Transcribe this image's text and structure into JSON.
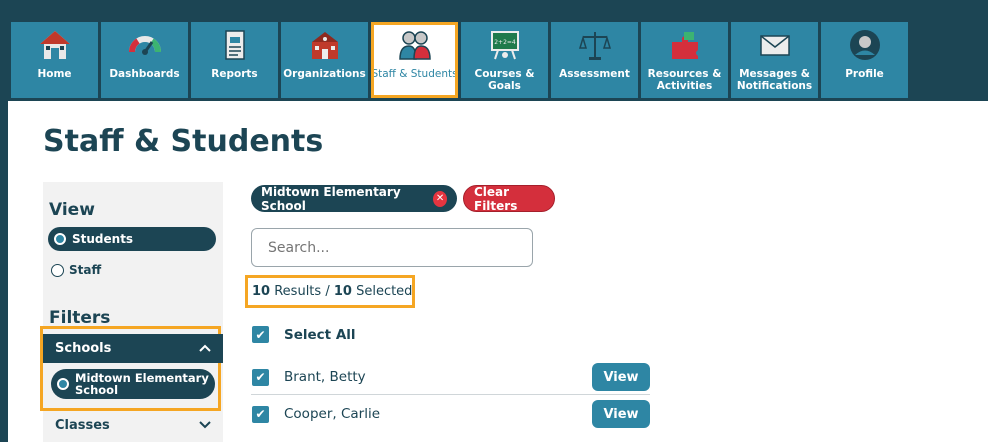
{
  "nav": {
    "items": [
      {
        "label": "Home",
        "icon": "home-icon"
      },
      {
        "label": "Dashboards",
        "icon": "gauge-icon"
      },
      {
        "label": "Reports",
        "icon": "report-icon"
      },
      {
        "label": "Organizations",
        "icon": "school-building-icon"
      },
      {
        "label": "Staff & Students",
        "icon": "people-icon",
        "active": true
      },
      {
        "label": "Courses & Goals",
        "icon": "chalkboard-icon"
      },
      {
        "label": "Assessment",
        "icon": "scale-icon"
      },
      {
        "label": "Resources & Activities",
        "icon": "puzzle-icon"
      },
      {
        "label": "Messages & Notifications",
        "icon": "envelope-icon"
      },
      {
        "label": "Profile",
        "icon": "user-icon"
      }
    ]
  },
  "page": {
    "title": "Staff & Students"
  },
  "sidebar": {
    "view_heading": "View",
    "view_options": [
      {
        "label": "Students",
        "selected": true
      },
      {
        "label": "Staff",
        "selected": false
      }
    ],
    "filters_heading": "Filters",
    "schools_label": "Schools",
    "school_selected": "Midtown Elementary School",
    "classes_label": "Classes"
  },
  "filters": {
    "active_chip": "Midtown Elementary School",
    "clear_label": "Clear Filters"
  },
  "search": {
    "placeholder": "Search..."
  },
  "results": {
    "count": "10",
    "results_word": "Results",
    "selected": "10",
    "selected_word": "Selected"
  },
  "list": {
    "select_all": "Select All",
    "view_label": "View",
    "rows": [
      {
        "name": "Brant, Betty",
        "checked": true
      },
      {
        "name": "Cooper, Carlie",
        "checked": true
      }
    ]
  },
  "colors": {
    "navy": "#1c4554",
    "teal": "#2e86a4",
    "highlight": "#f5a623",
    "danger": "#d42f3c"
  }
}
